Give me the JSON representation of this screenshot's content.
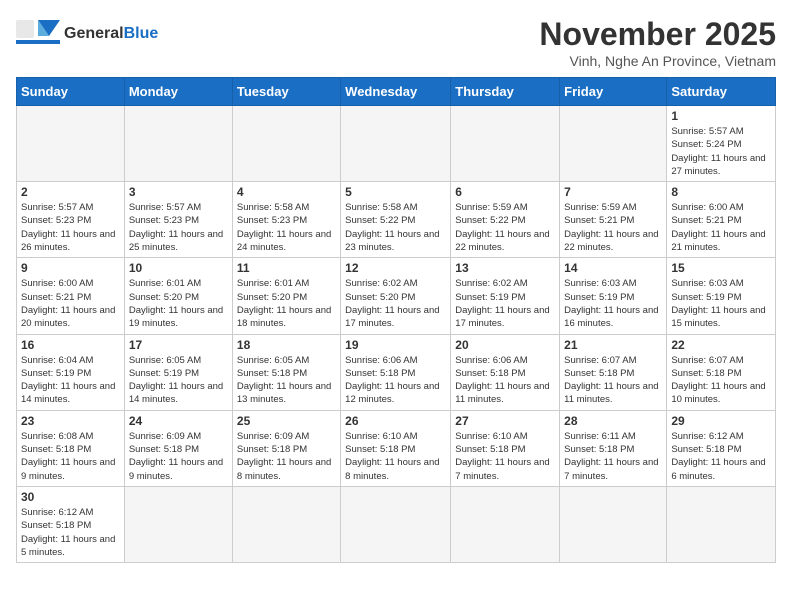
{
  "header": {
    "logo_general": "General",
    "logo_blue": "Blue",
    "month": "November 2025",
    "location": "Vinh, Nghe An Province, Vietnam"
  },
  "weekdays": [
    "Sunday",
    "Monday",
    "Tuesday",
    "Wednesday",
    "Thursday",
    "Friday",
    "Saturday"
  ],
  "days": {
    "1": {
      "sunrise": "5:57 AM",
      "sunset": "5:24 PM",
      "daylight": "11 hours and 27 minutes."
    },
    "2": {
      "sunrise": "5:57 AM",
      "sunset": "5:23 PM",
      "daylight": "11 hours and 26 minutes."
    },
    "3": {
      "sunrise": "5:57 AM",
      "sunset": "5:23 PM",
      "daylight": "11 hours and 25 minutes."
    },
    "4": {
      "sunrise": "5:58 AM",
      "sunset": "5:23 PM",
      "daylight": "11 hours and 24 minutes."
    },
    "5": {
      "sunrise": "5:58 AM",
      "sunset": "5:22 PM",
      "daylight": "11 hours and 23 minutes."
    },
    "6": {
      "sunrise": "5:59 AM",
      "sunset": "5:22 PM",
      "daylight": "11 hours and 22 minutes."
    },
    "7": {
      "sunrise": "5:59 AM",
      "sunset": "5:21 PM",
      "daylight": "11 hours and 22 minutes."
    },
    "8": {
      "sunrise": "6:00 AM",
      "sunset": "5:21 PM",
      "daylight": "11 hours and 21 minutes."
    },
    "9": {
      "sunrise": "6:00 AM",
      "sunset": "5:21 PM",
      "daylight": "11 hours and 20 minutes."
    },
    "10": {
      "sunrise": "6:01 AM",
      "sunset": "5:20 PM",
      "daylight": "11 hours and 19 minutes."
    },
    "11": {
      "sunrise": "6:01 AM",
      "sunset": "5:20 PM",
      "daylight": "11 hours and 18 minutes."
    },
    "12": {
      "sunrise": "6:02 AM",
      "sunset": "5:20 PM",
      "daylight": "11 hours and 17 minutes."
    },
    "13": {
      "sunrise": "6:02 AM",
      "sunset": "5:19 PM",
      "daylight": "11 hours and 17 minutes."
    },
    "14": {
      "sunrise": "6:03 AM",
      "sunset": "5:19 PM",
      "daylight": "11 hours and 16 minutes."
    },
    "15": {
      "sunrise": "6:03 AM",
      "sunset": "5:19 PM",
      "daylight": "11 hours and 15 minutes."
    },
    "16": {
      "sunrise": "6:04 AM",
      "sunset": "5:19 PM",
      "daylight": "11 hours and 14 minutes."
    },
    "17": {
      "sunrise": "6:05 AM",
      "sunset": "5:19 PM",
      "daylight": "11 hours and 14 minutes."
    },
    "18": {
      "sunrise": "6:05 AM",
      "sunset": "5:18 PM",
      "daylight": "11 hours and 13 minutes."
    },
    "19": {
      "sunrise": "6:06 AM",
      "sunset": "5:18 PM",
      "daylight": "11 hours and 12 minutes."
    },
    "20": {
      "sunrise": "6:06 AM",
      "sunset": "5:18 PM",
      "daylight": "11 hours and 11 minutes."
    },
    "21": {
      "sunrise": "6:07 AM",
      "sunset": "5:18 PM",
      "daylight": "11 hours and 11 minutes."
    },
    "22": {
      "sunrise": "6:07 AM",
      "sunset": "5:18 PM",
      "daylight": "11 hours and 10 minutes."
    },
    "23": {
      "sunrise": "6:08 AM",
      "sunset": "5:18 PM",
      "daylight": "11 hours and 9 minutes."
    },
    "24": {
      "sunrise": "6:09 AM",
      "sunset": "5:18 PM",
      "daylight": "11 hours and 9 minutes."
    },
    "25": {
      "sunrise": "6:09 AM",
      "sunset": "5:18 PM",
      "daylight": "11 hours and 8 minutes."
    },
    "26": {
      "sunrise": "6:10 AM",
      "sunset": "5:18 PM",
      "daylight": "11 hours and 8 minutes."
    },
    "27": {
      "sunrise": "6:10 AM",
      "sunset": "5:18 PM",
      "daylight": "11 hours and 7 minutes."
    },
    "28": {
      "sunrise": "6:11 AM",
      "sunset": "5:18 PM",
      "daylight": "11 hours and 7 minutes."
    },
    "29": {
      "sunrise": "6:12 AM",
      "sunset": "5:18 PM",
      "daylight": "11 hours and 6 minutes."
    },
    "30": {
      "sunrise": "6:12 AM",
      "sunset": "5:18 PM",
      "daylight": "11 hours and 5 minutes."
    }
  }
}
